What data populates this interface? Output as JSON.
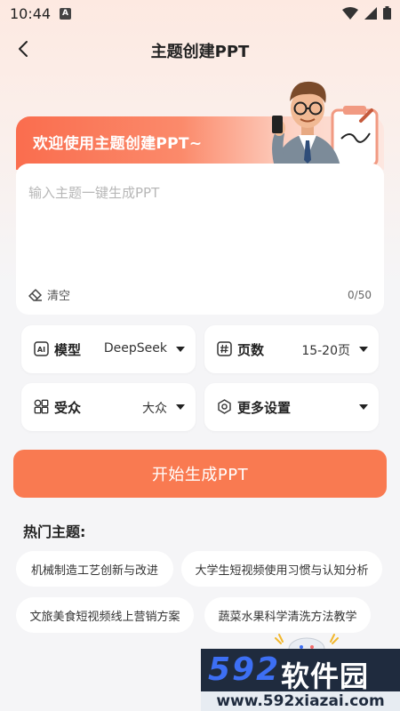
{
  "status_bar": {
    "time": "10:44",
    "badge": "A"
  },
  "header": {
    "title": "主题创建PPT"
  },
  "welcome": {
    "text": "欢迎使用主题创建PPT~"
  },
  "input": {
    "placeholder": "输入主题一键生成PPT",
    "value": "",
    "clear_label": "清空",
    "counter": "0/50"
  },
  "options": {
    "model": {
      "label": "模型",
      "value": "DeepSeek",
      "icon": "ai-icon"
    },
    "pages": {
      "label": "页数",
      "value": "15-20页",
      "icon": "hash-icon"
    },
    "audience": {
      "label": "受众",
      "value": "大众",
      "icon": "grid-icon"
    },
    "more": {
      "label": "更多设置",
      "value": "",
      "icon": "settings-icon"
    }
  },
  "generate_button": "开始生成PPT",
  "hot_topics": {
    "title": "热门主题:",
    "items": [
      "机械制造工艺创新与改进",
      "大学生短视频使用习惯与认知分析",
      "文旅美食短视频线上营销方案",
      "蔬菜水果科学清洗方法教学"
    ]
  },
  "watermark": {
    "number": "592",
    "name": "软件园",
    "url": "www.592xiazai.com"
  },
  "colors": {
    "accent": "#f97a51",
    "header_gradient_start": "#fa6d4e",
    "watermark_dark": "#1f2b3e",
    "watermark_blue": "#3d6ff4"
  }
}
